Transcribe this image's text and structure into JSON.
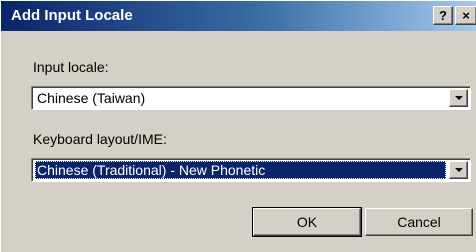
{
  "window": {
    "title": "Add Input Locale",
    "help_label": "?",
    "close_label": "×"
  },
  "input_locale": {
    "label": "Input locale:",
    "value": "Chinese (Taiwan)"
  },
  "keyboard_layout": {
    "label": "Keyboard layout/IME:",
    "value": "Chinese (Traditional) - New Phonetic"
  },
  "buttons": {
    "ok_label": "OK",
    "cancel_label": "Cancel"
  },
  "colors": {
    "title_bar": "#0a246a",
    "selection": "#0a246a",
    "face": "#d4d0c8"
  }
}
